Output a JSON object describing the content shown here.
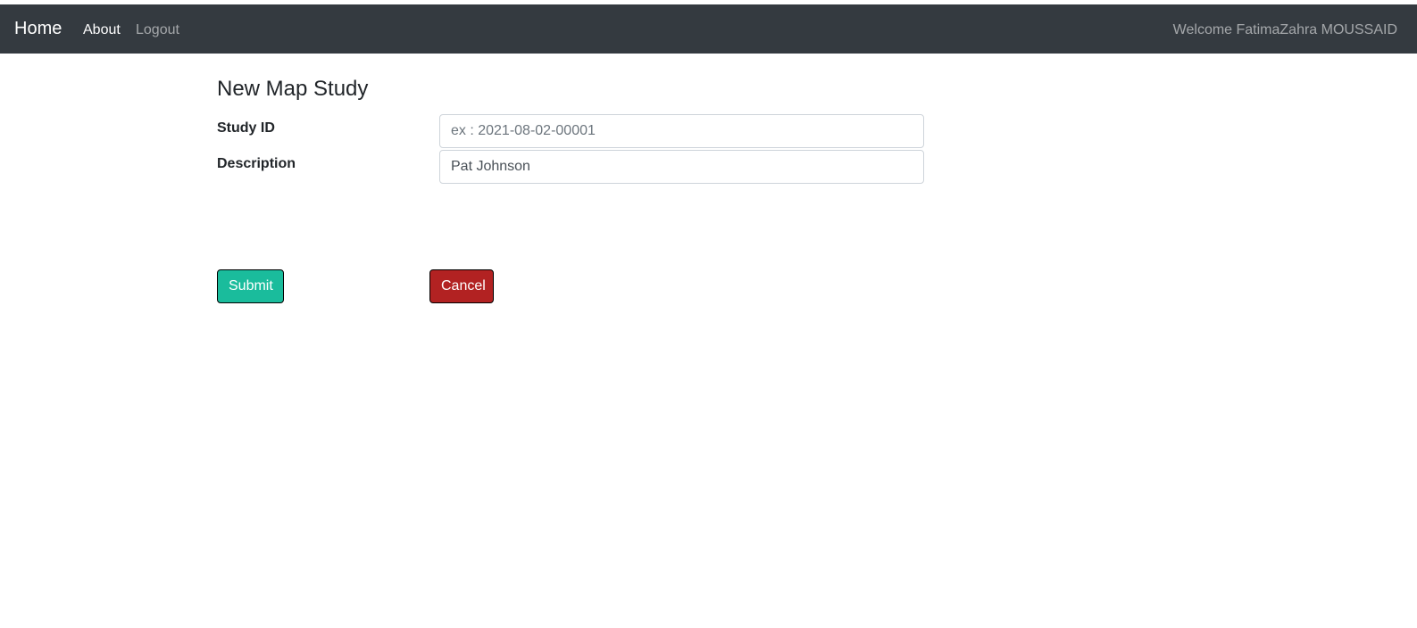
{
  "navbar": {
    "brand": "Home",
    "links": {
      "about": "About",
      "logout": "Logout"
    },
    "welcome": "Welcome FatimaZahra MOUSSAID"
  },
  "form": {
    "title": "New Map Study",
    "study_id": {
      "label": "Study ID",
      "value": "",
      "placeholder": "ex : 2021-08-02-00001"
    },
    "description": {
      "label": "Description",
      "value": "Pat Johnson",
      "placeholder": ""
    },
    "submit_label": "Submit",
    "cancel_label": "Cancel"
  },
  "colors": {
    "navbar_bg": "#343a40",
    "submit_bg": "#1abc9c",
    "cancel_bg": "#b22222"
  }
}
